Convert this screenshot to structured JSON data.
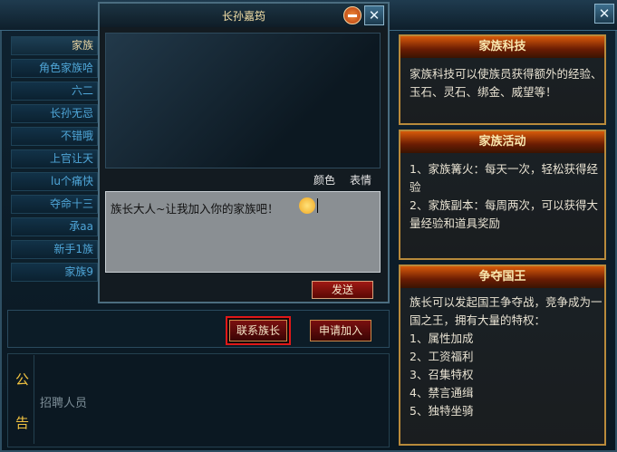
{
  "window": {
    "close_icon": "✕"
  },
  "members": [
    "家族",
    "角色家族哈",
    "六二",
    "长孙无忌",
    "不错哦",
    "上官让天",
    "lu个痛快",
    "夺命十三",
    "承aa",
    "新手1族",
    "家族9"
  ],
  "buttons": {
    "contact_leader": "联系族长",
    "apply_join": "申请加入"
  },
  "notice": {
    "title_char_1": "公",
    "title_char_2": "告",
    "text": "招聘人员"
  },
  "dialog": {
    "title": "长孙嘉筠",
    "close_icon": "✕",
    "tool_color": "颜色",
    "tool_emoji": "表情",
    "input_text": "族长大人~让我加入你的家族吧！",
    "send": "发送"
  },
  "panels": [
    {
      "title": "家族科技",
      "text": "家族科技可以使族员获得额外的经验、玉石、灵石、绑金、威望等！"
    },
    {
      "title": "家族活动",
      "lines": [
        "1、家族篝火：每天一次，轻松获得经验",
        "2、家族副本：每周两次，可以获得大量经验和道具奖励"
      ]
    },
    {
      "title": "争夺国王",
      "lines": [
        "族长可以发起国王争夺战，竞争成为一国之王，拥有大量的特权：",
        "1、属性加成",
        "2、工资福利",
        "3、召集特权",
        "4、禁言通缉",
        "5、独特坐骑"
      ]
    }
  ]
}
